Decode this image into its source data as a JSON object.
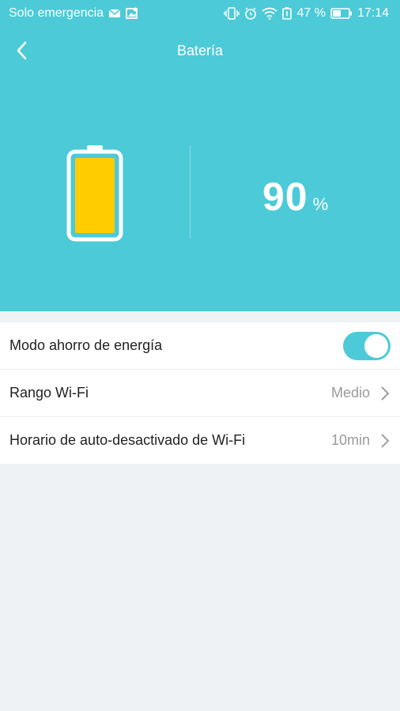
{
  "status_bar": {
    "carrier": "Solo emergencia",
    "battery_percent": "47 %",
    "time": "17:14"
  },
  "header": {
    "title": "Batería"
  },
  "battery": {
    "level_text": "90",
    "unit": "%",
    "level_fraction": 0.9
  },
  "settings": {
    "power_saving": {
      "label": "Modo ahorro de energía",
      "enabled": true
    },
    "wifi_range": {
      "label": "Rango Wi-Fi",
      "value": "Medio"
    },
    "wifi_schedule": {
      "label": "Horario de auto-desactivado de Wi-Fi",
      "value": "10min"
    }
  },
  "colors": {
    "accent": "#4ccad7",
    "battery_fill": "#ffcc00",
    "background": "#eff2f5"
  }
}
